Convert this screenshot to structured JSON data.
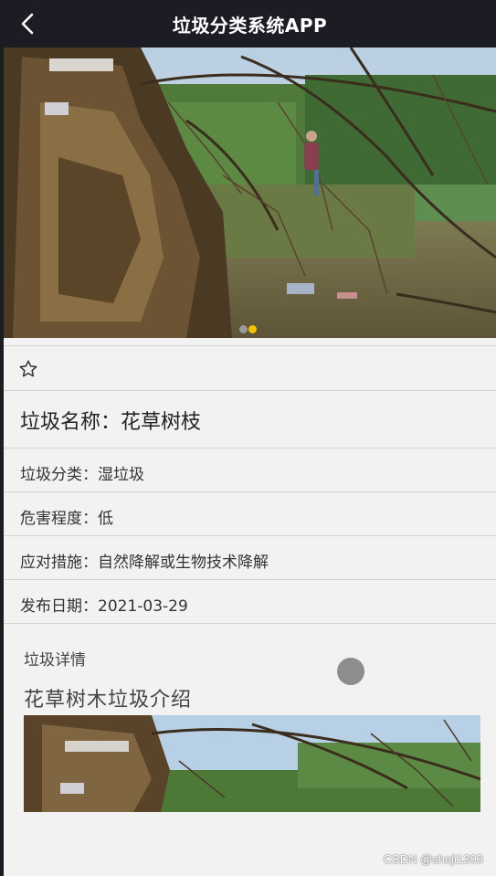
{
  "header": {
    "title": "垃圾分类系统APP",
    "back_icon": "chevron-left-icon"
  },
  "hero": {
    "image": "photo of tangled dry tree branches and twigs on a riverbank with a person walking in background",
    "carousel_dot_count": 2,
    "active_dot_color": "#f5c400",
    "inactive_dot_color": "#9a9a9a"
  },
  "favorite": {
    "icon": "star-outline-icon"
  },
  "item": {
    "name_line": "垃圾名称：花草树枝",
    "category_line": "垃圾分类：湿垃圾",
    "hazard_line": "危害程度：低",
    "measure_line": "应对措施：自然降解或生物技术降解",
    "date_line": "发布日期：2021-03-29"
  },
  "detail": {
    "section_label": "垃圾详情",
    "title": "花草树木垃圾介绍",
    "image": "cropped photo of tree branches against sky"
  },
  "watermark": "CSDN @sheji1303",
  "colors": {
    "navbar_bg": "#1c1c24",
    "page_bg": "#f2f2f3",
    "divider": "#d4d4d6"
  }
}
